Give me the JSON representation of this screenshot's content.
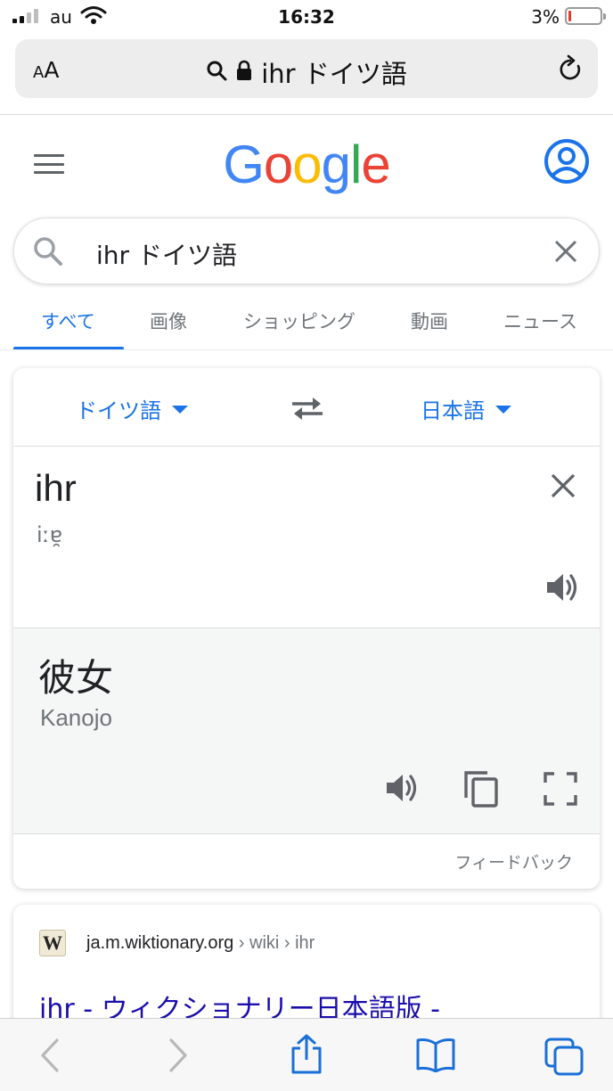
{
  "status_bar": {
    "carrier": "au",
    "time": "16:32",
    "battery_percent": "3%",
    "battery_level": 0.03,
    "battery_color": "#e53935"
  },
  "url_bar": {
    "text_size_label_small": "A",
    "text_size_label_large": "A",
    "url_text": "ihr ドイツ語",
    "icons": [
      "search-icon",
      "lock-icon",
      "reload-icon"
    ]
  },
  "header": {
    "logo_letters": [
      "G",
      "o",
      "o",
      "g",
      "l",
      "e"
    ],
    "logo_colors": [
      "#4285F4",
      "#EA4335",
      "#FBBC05",
      "#4285F4",
      "#34A853",
      "#EA4335"
    ],
    "icons": [
      "hamburger-menu-icon",
      "account-icon"
    ]
  },
  "search": {
    "query": "ihr ドイツ語"
  },
  "tabs": {
    "items": [
      {
        "label": "すべて",
        "active": true
      },
      {
        "label": "画像",
        "active": false
      },
      {
        "label": "ショッピング",
        "active": false
      },
      {
        "label": "動画",
        "active": false
      },
      {
        "label": "ニュース",
        "active": false
      }
    ]
  },
  "translate": {
    "source_language": "ドイツ語",
    "target_language": "日本語",
    "source_text": "ihr",
    "source_phonetic": "iːɐ̯",
    "target_text": "彼女",
    "target_romanization": "Kanojo",
    "feedback_label": "フィードバック"
  },
  "result": {
    "favicon_letter": "W",
    "domain": "ja.m.wiktionary.org",
    "path": " › wiki › ihr",
    "title": "ihr - ウィクショナリー日本語版 -"
  },
  "colors": {
    "accent_blue": "#1a73e8",
    "link_blue": "#1a0dab",
    "safari_blue": "#1a6fd9",
    "icon_gray": "#5f6368"
  }
}
